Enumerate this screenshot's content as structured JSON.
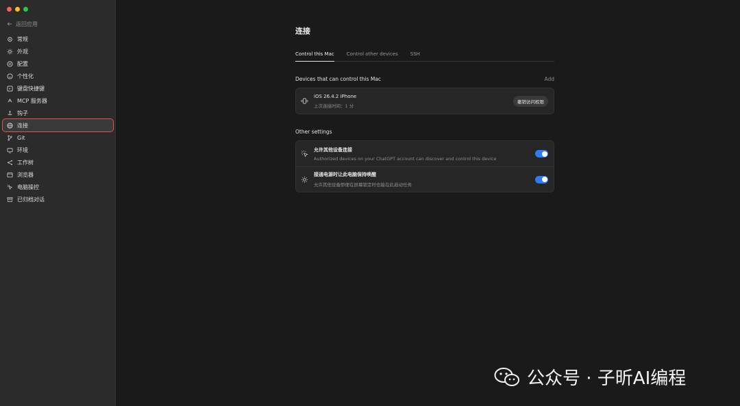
{
  "window": {
    "traffic_lights": [
      "#ff5f57",
      "#febc2e",
      "#28c840"
    ]
  },
  "sidebar": {
    "back_label": "返回应用",
    "items": [
      {
        "label": "常规",
        "icon": "gear-icon"
      },
      {
        "label": "外观",
        "icon": "sun-icon"
      },
      {
        "label": "配置",
        "icon": "sliders-icon"
      },
      {
        "label": "个性化",
        "icon": "smile-icon"
      },
      {
        "label": "键盘快捷键",
        "icon": "keyboard-icon"
      },
      {
        "label": "MCP 服务器",
        "icon": "server-icon"
      },
      {
        "label": "钩子",
        "icon": "hook-icon"
      },
      {
        "label": "连接",
        "icon": "globe-icon",
        "active": true
      },
      {
        "label": "Git",
        "icon": "git-branch-icon"
      },
      {
        "label": "环境",
        "icon": "monitor-icon"
      },
      {
        "label": "工作树",
        "icon": "tree-icon"
      },
      {
        "label": "浏览器",
        "icon": "browser-icon"
      },
      {
        "label": "电脑操控",
        "icon": "cursor-icon"
      },
      {
        "label": "已归档对话",
        "icon": "archive-icon"
      }
    ]
  },
  "main": {
    "title": "连接",
    "tabs": [
      "Control this Mac",
      "Control other devices",
      "SSH"
    ],
    "active_tab": 0,
    "devices_section": {
      "title": "Devices that can control this Mac",
      "add_label": "Add",
      "devices": [
        {
          "name": "iOS 26.4.2 iPhone",
          "subtitle": "上次连接时间：1 分",
          "action": "撤销访问权限",
          "icon": "phone-vibrate-icon"
        }
      ]
    },
    "other_section": {
      "title": "Other settings",
      "settings": [
        {
          "title": "允许其他设备连接",
          "description": "Authorized devices on your ChatGPT account can discover and control this device",
          "enabled": true,
          "icon": "cursor-sparkle-icon"
        },
        {
          "title": "接通电源时让此电脑保持唤醒",
          "description": "允许其他设备即便在屏幕锁定时也能在此启动任务",
          "enabled": true,
          "icon": "sun-icon"
        }
      ]
    }
  },
  "watermark": {
    "text": "公众号 · 子昕AI编程",
    "icon": "wechat-logo-icon"
  },
  "colors": {
    "accent_toggle": "#2f7bf5",
    "highlight_outline": "#e0534f"
  }
}
